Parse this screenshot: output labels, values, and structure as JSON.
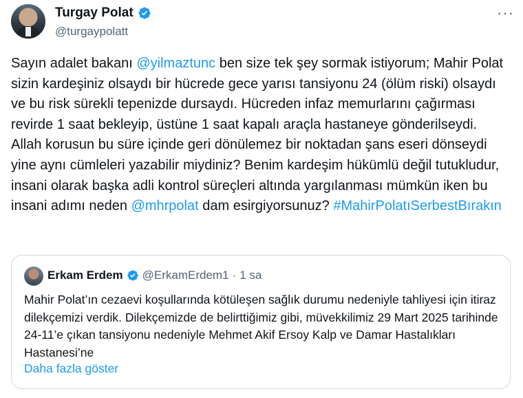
{
  "author": {
    "name": "Turgay Polat",
    "handle": "@turgaypolatt",
    "verified_color": "#1d9bf0"
  },
  "more_menu": "···",
  "tweet": {
    "segments": [
      {
        "text": "Sayın adalet bakanı ",
        "link": false
      },
      {
        "text": "@yilmaztunc",
        "link": true
      },
      {
        "text": " ben size tek şey sormak istiyorum; Mahir Polat sizin kardeşiniz olsaydı bir hücrede gece yarısı tansiyonu 24 (ölüm riski) olsaydı ve bu risk sürekli tepenizde dursaydı. Hücreden infaz memurlarını çağırması revirde 1 saat bekleyip, üstüne 1 saat kapalı araçla hastaneye gönderilseydi. Allah korusun bu süre içinde geri dönülemez bir noktadan şans eseri dönseydi yine aynı cümleleri yazabilir miydiniz? Benim kardeşim hükümlü değil tutukludur, insani olarak başka adli kontrol süreçleri altında yargılanması mümkün iken bu insani adımı neden ",
        "link": false
      },
      {
        "text": "@mhrpolat",
        "link": true
      },
      {
        "text": " dam esirgiyorsunuz? ",
        "link": false
      },
      {
        "text": "#MahirPolatıSerbestBırakın",
        "link": true
      }
    ]
  },
  "quote": {
    "name": "Erkam Erdem",
    "handle": "@ErkamErdem1",
    "separator": "·",
    "time": "1 sa",
    "text": "Mahir Polat’ın cezaevi koşullarında kötüleşen sağlık durumu nedeniyle tahliyesi için itiraz dilekçemizi verdik. Dilekçemizde de belirttiğimiz gibi, müvekkilimiz 29 Mart 2025 tarihinde 24-11’e çıkan tansiyonu nedeniyle Mehmet Akif Ersoy Kalp ve Damar Hastalıkları Hastanesi’ne",
    "show_more": "Daha fazla göster"
  },
  "colors": {
    "link": "#1d9bf0",
    "text": "#0f1419",
    "secondary": "#536471",
    "border": "#cfd9de"
  }
}
